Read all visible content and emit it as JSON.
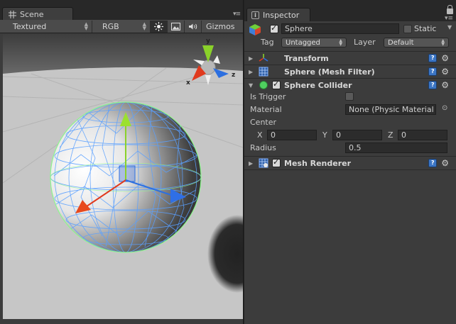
{
  "scene": {
    "tab_label": "Scene",
    "shading_mode": "Textured",
    "render_mode": "RGB",
    "gizmos_label": "Gizmos",
    "orientation_axes": {
      "x": "x",
      "y": "y",
      "z": "z"
    }
  },
  "inspector": {
    "tab_label": "Inspector",
    "gameobject": {
      "name": "Sphere",
      "static_label": "Static",
      "tag_label": "Tag",
      "tag_value": "Untagged",
      "layer_label": "Layer",
      "layer_value": "Default"
    },
    "components": {
      "transform": {
        "title": "Transform"
      },
      "mesh_filter": {
        "title": "Sphere (Mesh Filter)"
      },
      "collider": {
        "title": "Sphere Collider",
        "is_trigger_label": "Is Trigger",
        "material_label": "Material",
        "material_value": "None (Physic Material",
        "center_label": "Center",
        "x_label": "X",
        "x_value": "0",
        "y_label": "Y",
        "y_value": "0",
        "z_label": "Z",
        "z_value": "0",
        "radius_label": "Radius",
        "radius_value": "0.5"
      },
      "mesh_renderer": {
        "title": "Mesh Renderer"
      }
    },
    "help_glyph": "?",
    "gear_glyph": "⚙"
  },
  "colors": {
    "panel_bg": "#3c3c3c",
    "viewport_bg": "#c8c8c8",
    "axis_x": "#e03a1e",
    "axis_y": "#8ad12a",
    "axis_z": "#2c6fe0",
    "wireframe": "#5aa0ff",
    "collider_wire": "#8ef58e"
  }
}
